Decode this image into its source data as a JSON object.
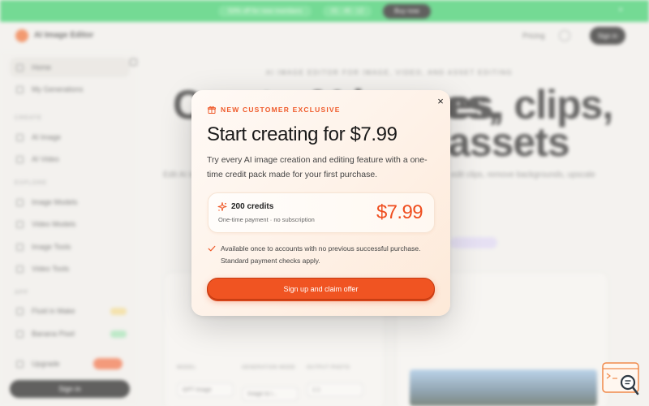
{
  "promo": {
    "message": "50% off for new members",
    "timer": "01 : 45 : 12",
    "button": "Buy now",
    "close": "×"
  },
  "header": {
    "app_name": "AI Image Editor",
    "pricing": "Pricing",
    "sign_in": "Sign in"
  },
  "sidebar": {
    "items": [
      {
        "label": "Home"
      },
      {
        "label": "My Generations"
      }
    ],
    "create_heading": "CREATE",
    "create_items": [
      {
        "label": "AI Image"
      },
      {
        "label": "AI Video"
      }
    ],
    "explore_heading": "EXPLORE",
    "explore_items": [
      {
        "label": "Image Models"
      },
      {
        "label": "Video Models"
      },
      {
        "label": "Image Tools"
      },
      {
        "label": "Video Tools"
      }
    ],
    "app_heading": "APP",
    "app_items": [
      {
        "label": "Fluid in Make"
      },
      {
        "label": "Banana Pixel"
      }
    ],
    "tokens": "Upgrade",
    "sign_in": "Sign in"
  },
  "hero": {
    "kicker": "AI IMAGE EDITOR FOR IMAGE, VIDEO, AND ASSET EDITING",
    "title_left": "Create AI images,",
    "title_right_1": "es, clips,",
    "title_right_2": "assets",
    "subtitle_left": "Edit AI images to restyle, retouch, remove",
    "subtitle_right": "edit clips, remove backgrounds, upscale"
  },
  "form": {
    "model_label": "MODEL",
    "model_value": "GPT Image",
    "gen_mode_label": "GENERATION MODE",
    "gen_mode_value": "Image to i...",
    "output_label": "OUTPUT PHOTO",
    "output_value": "1:1"
  },
  "modal": {
    "close": "×",
    "eyebrow": "NEW CUSTOMER EXCLUSIVE",
    "title": "Start creating for $7.99",
    "description": "Try every AI image creation and editing feature with a one-time credit pack made for your first purchase.",
    "credits": "200 credits",
    "credits_sub": "One-time payment · no subscription",
    "price": "$7.99",
    "notice": "Available once to accounts with no previous successful purchase. Standard payment checks apply.",
    "cta": "Sign up and claim offer",
    "accent_color": "#ef5a2a"
  },
  "icons": {
    "eyebrow": "gift-icon",
    "credits": "sparkle-icon",
    "notice": "check-icon",
    "widget": "chat-search-icon"
  }
}
